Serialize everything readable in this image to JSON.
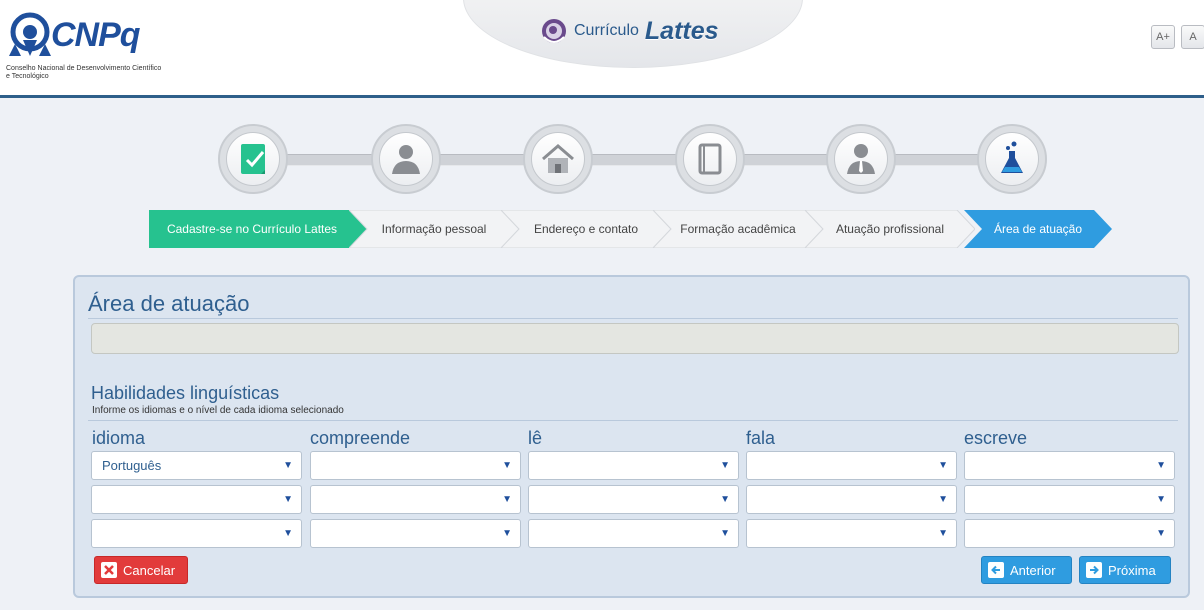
{
  "header": {
    "org_name": "CNPq",
    "org_full_name": "Conselho Nacional de Desenvolvimento Científico e Tecnológico",
    "app_title_small": "Currículo",
    "app_title_big": "Lattes",
    "font_increase_label": "A+",
    "font_reset_label": "A"
  },
  "steps": [
    {
      "label": "Cadastre-se no Currículo Lattes",
      "icon": "signup-check-icon",
      "state": "completed"
    },
    {
      "label": "Informação pessoal",
      "icon": "person-icon",
      "state": "inactive"
    },
    {
      "label": "Endereço e contato",
      "icon": "house-icon",
      "state": "inactive"
    },
    {
      "label": "Formação acadêmica",
      "icon": "book-icon",
      "state": "inactive"
    },
    {
      "label": "Atuação profissional",
      "icon": "professional-person-icon",
      "state": "inactive"
    },
    {
      "label": "Área de atuação",
      "icon": "flask-icon",
      "state": "active"
    }
  ],
  "colors": {
    "completed": "#26c28f",
    "active": "#2f9ce0",
    "cancel": "#e23b3b",
    "title": "#2f5f8f"
  },
  "panel": {
    "title": "Área de atuação",
    "search_value": "",
    "section_title": "Habilidades linguísticas",
    "section_subtitle": "Informe os idiomas e o nível de cada idioma selecionado",
    "columns": [
      "idioma",
      "compreende",
      "lê",
      "fala",
      "escreve"
    ],
    "rows": [
      [
        "Português",
        "",
        "",
        "",
        ""
      ],
      [
        "",
        "",
        "",
        "",
        ""
      ],
      [
        "",
        "",
        "",
        "",
        ""
      ]
    ]
  },
  "buttons": {
    "cancel": "Cancelar",
    "previous": "Anterior",
    "next": "Próxima"
  }
}
